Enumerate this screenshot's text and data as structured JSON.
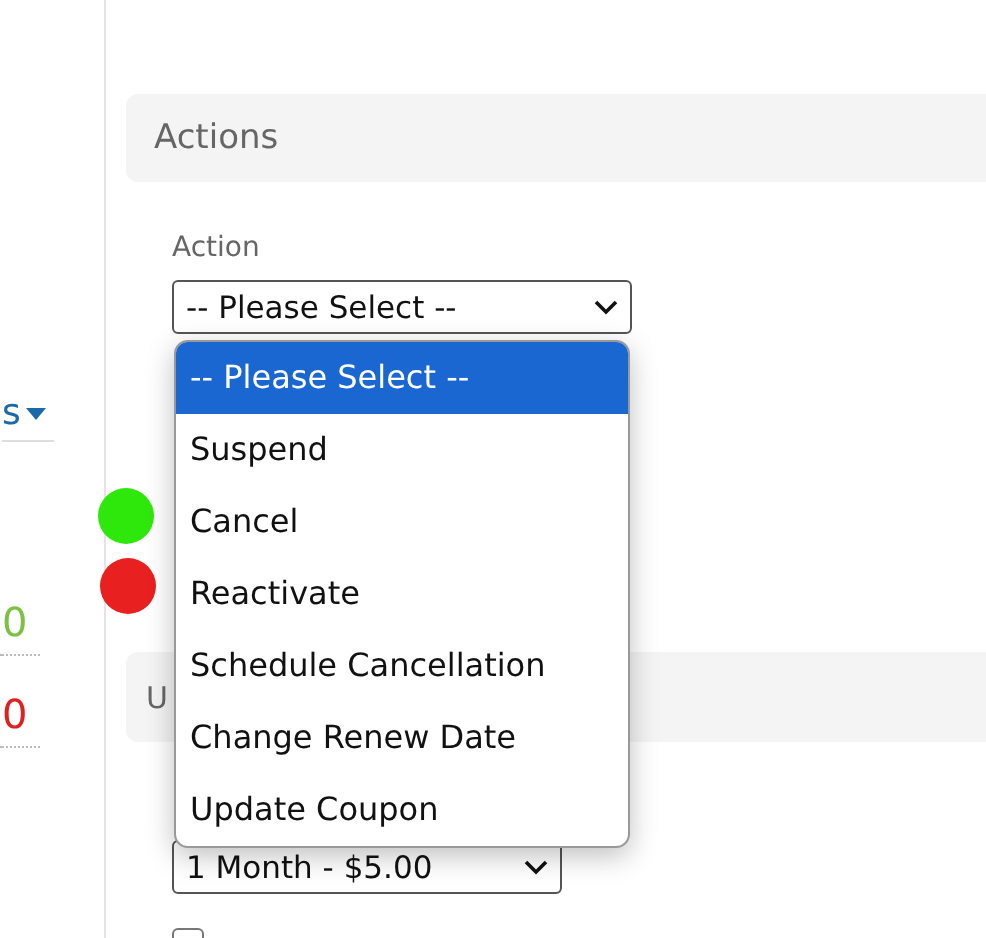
{
  "sidebar": {
    "menu_label": "s",
    "values": [
      {
        "text": "0",
        "color": "#7cc242"
      },
      {
        "text": "0",
        "color": "#e02020"
      }
    ]
  },
  "status_dots": [
    {
      "color": "#2ee80c"
    },
    {
      "color": "#e82020"
    }
  ],
  "actions_panel": {
    "title": "Actions",
    "field_label": "Action",
    "select": {
      "value": "-- Please Select --",
      "expanded": true,
      "options": [
        {
          "label": "-- Please Select --",
          "selected": true
        },
        {
          "label": "Suspend",
          "selected": false
        },
        {
          "label": "Cancel",
          "selected": false
        },
        {
          "label": "Reactivate",
          "selected": false
        },
        {
          "label": "Schedule Cancellation",
          "selected": false
        },
        {
          "label": "Change Renew Date",
          "selected": false
        },
        {
          "label": "Update Coupon",
          "selected": false
        }
      ]
    }
  },
  "second_panel": {
    "title": "U",
    "select": {
      "value": "1 Month - $5.00"
    },
    "checkbox": {
      "checked": false
    }
  }
}
